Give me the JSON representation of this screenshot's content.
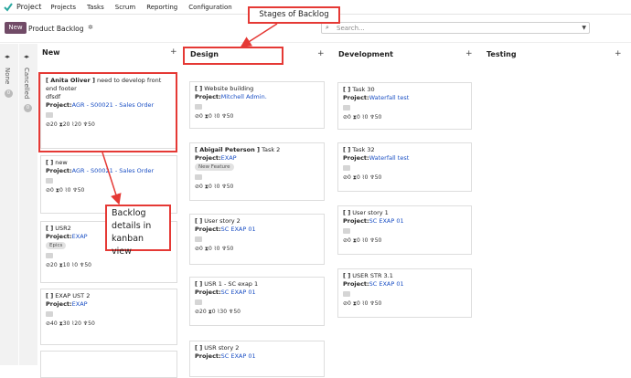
{
  "navbar": {
    "app": "Project",
    "menus": [
      "Projects",
      "Tasks",
      "Scrum",
      "Reporting",
      "Configuration"
    ]
  },
  "control": {
    "new_label": "New",
    "breadcrumb": "Product Backlog",
    "search_placeholder": "Search..."
  },
  "folded_columns": [
    {
      "name": "None",
      "count": "0"
    },
    {
      "name": "Cancelled",
      "count": "0"
    }
  ],
  "columns": [
    {
      "name": "New",
      "plus": "+"
    },
    {
      "name": "Design",
      "plus": "+"
    },
    {
      "name": "Development",
      "plus": "+"
    },
    {
      "name": "Testing",
      "plus": "+"
    }
  ],
  "cards": {
    "new": [
      {
        "title_bold": "[ Anita Oliver ]",
        "title": " need to develop front end footer",
        "extra": "dfsdf",
        "project_label": "Project:",
        "project": "AGR - S00021 - Sales Order",
        "stats": "⊘20 ⧗20 ⌇20 ♆50"
      },
      {
        "title_bold": "[ ]",
        "title": " new",
        "project_label": "Project:",
        "project": "AGR - S00021 - Sales Order",
        "stats": "⊘0 ⧗0 ⌇0 ♆50"
      },
      {
        "title_bold": "[ ]",
        "title": " USR2",
        "project_label": "Project:",
        "project": "EXAP",
        "tag": "Epics",
        "stats": "⊘20 ⧗10 ⌇0 ♆50"
      },
      {
        "title_bold": "[ ]",
        "title": " EXAP UST 2",
        "project_label": "Project:",
        "project": "EXAP",
        "stats": "⊘40 ⧗30 ⌇20 ♆50"
      }
    ],
    "design": [
      {
        "title_bold": "[ ]",
        "title": " Website building",
        "project_label": "Project:",
        "project": "Mitchell Admin.",
        "stats": "⊘0 ⧗0 ⌇0 ♆50"
      },
      {
        "title_bold": "[ Abigail Peterson ]",
        "title": " Task 2",
        "project_label": "Project:",
        "project": "EXAP",
        "tag": "New Feature",
        "stats": "⊘0 ⧗0 ⌇0 ♆50"
      },
      {
        "title_bold": "[ ]",
        "title": " User story 2",
        "project_label": "Project:",
        "project": "SC EXAP 01",
        "stats": "⊘0 ⧗0 ⌇0 ♆50"
      },
      {
        "title_bold": "[ ]",
        "title": " USR 1 - SC exap 1",
        "project_label": "Project:",
        "project": "SC EXAP 01",
        "stats": "⊘20 ⧗0 ⌇30 ♆50"
      },
      {
        "title_bold": "[ ]",
        "title": " USR story 2",
        "project_label": "Project:",
        "project": "SC EXAP 01"
      }
    ],
    "development": [
      {
        "title_bold": "[ ]",
        "title": " Task 30",
        "project_label": "Project:",
        "project": "Waterfall test",
        "stats": "⊘0 ⧗0 ⌇0 ♆50"
      },
      {
        "title_bold": "[ ]",
        "title": " Task 32",
        "project_label": "Project:",
        "project": "Waterfall test",
        "stats": "⊘0 ⧗0 ⌇0 ♆50"
      },
      {
        "title_bold": "[ ]",
        "title": " User story 1",
        "project_label": "Project:",
        "project": "SC EXAP 01",
        "stats": "⊘0 ⧗0 ⌇0 ♆50"
      },
      {
        "title_bold": "[ ]",
        "title": " USER STR 3.1",
        "project_label": "Project:",
        "project": "SC EXAP 01",
        "stats": "⊘0 ⧗0 ⌇0 ♆50"
      }
    ]
  },
  "annotations": {
    "stages": "Stages of Backlog",
    "details": "Backlog details in kanban view"
  },
  "colors": {
    "accent": "#714b67",
    "annotation": "#e53935",
    "link": "#1a4fc4"
  }
}
